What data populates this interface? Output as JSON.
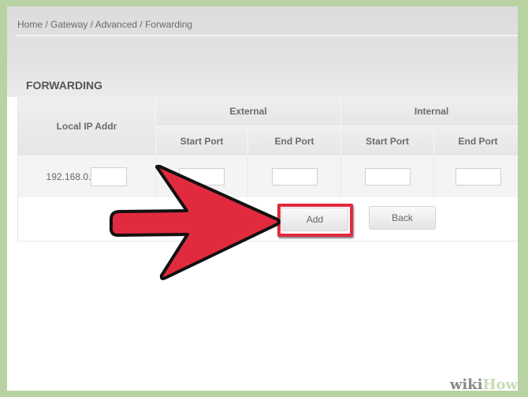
{
  "breadcrumb": "Home / Gateway / Advanced / Forwarding",
  "section_title": "FORWARDING",
  "table": {
    "col_local_ip": "Local IP Addr",
    "group_external": "External",
    "group_internal": "Internal",
    "ext_start_port": "Start Port",
    "ext_end_port": "End Port",
    "int_start_port": "Start Port",
    "int_end_port": "End Port",
    "ip_prefix": "192.168.0.",
    "ip_suffix_value": "",
    "ext_start_value": "",
    "ext_end_value": "",
    "int_start_value": "",
    "int_end_value": ""
  },
  "buttons": {
    "add": "Add",
    "back": "Back"
  },
  "annotation": {
    "arrow_color": "#e22a3e",
    "highlight_color": "#e22a3e"
  },
  "watermark": {
    "wiki": "wiki",
    "how": "How"
  }
}
